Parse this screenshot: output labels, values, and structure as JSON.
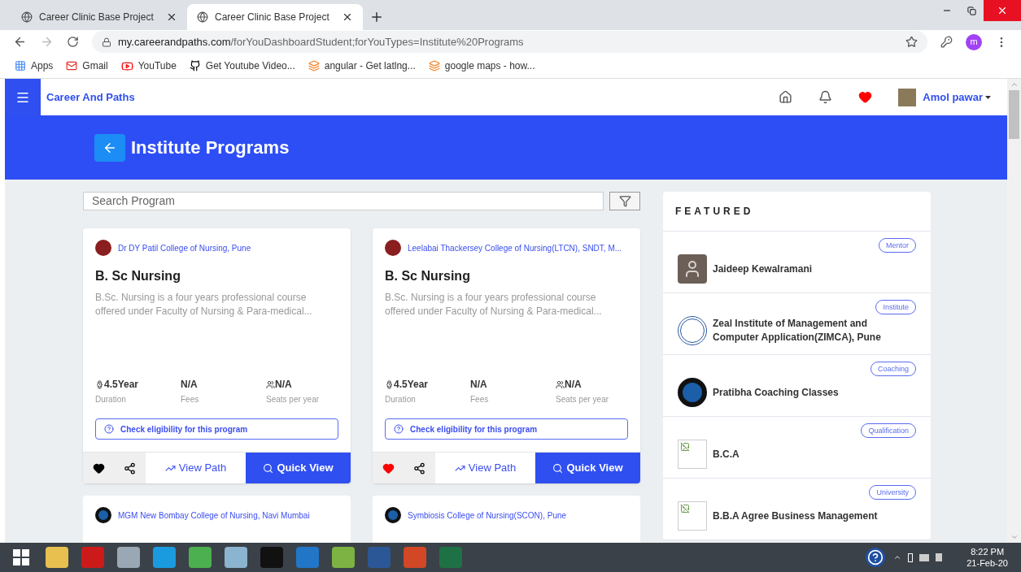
{
  "browser": {
    "tabs": [
      {
        "title": "Career Clinic Base Project",
        "selected": false
      },
      {
        "title": "Career Clinic Base Project",
        "selected": true
      }
    ],
    "url_host": "my.careerandpaths.com",
    "url_path": "/forYouDashboardStudent;forYouTypes=Institute%20Programs",
    "bookmarks": [
      {
        "label": "Apps",
        "kind": "apps"
      },
      {
        "label": "Gmail",
        "kind": "gmail"
      },
      {
        "label": "YouTube",
        "kind": "youtube"
      },
      {
        "label": "Get Youtube Video...",
        "kind": "github"
      },
      {
        "label": "angular - Get latlng...",
        "kind": "stack"
      },
      {
        "label": "google maps - how...",
        "kind": "stack"
      }
    ],
    "profile_initial": "m"
  },
  "app": {
    "brand": "Career And Paths",
    "user": "Amol pawar",
    "page_title": "Institute Programs",
    "search_placeholder": "Search Program",
    "programs": [
      {
        "institute": "Dr DY Patil College of Nursing, Pune",
        "title": "B. Sc Nursing",
        "description": "B.Sc. Nursing is a four years professional course offered under Faculty of Nursing & Para-medical...",
        "duration": "4.5Year",
        "duration_label": "Duration",
        "fees": "N/A",
        "fees_label": "Fees",
        "seats": "N/A",
        "seats_label": "Seats per year",
        "eligibility": "Check eligibility for this program",
        "favorite": false,
        "view_path": "View Path",
        "quick_view": "Quick View"
      },
      {
        "institute": "Leelabai Thackersey College of Nursing(LTCN), SNDT, M...",
        "title": "B. Sc Nursing",
        "description": "B.Sc. Nursing is a four years professional course offered under Faculty of Nursing & Para-medical...",
        "duration": "4.5Year",
        "duration_label": "Duration",
        "fees": "N/A",
        "fees_label": "Fees",
        "seats": "N/A",
        "seats_label": "Seats per year",
        "eligibility": "Check eligibility for this program",
        "favorite": true,
        "view_path": "View Path",
        "quick_view": "Quick View"
      }
    ],
    "more_programs": [
      {
        "institute": "MGM New Bombay College of Nursing, Navi Mumbai"
      },
      {
        "institute": "Symbiosis College of Nursing(SCON), Pune"
      }
    ],
    "featured": {
      "title": "FEATURED",
      "items": [
        {
          "tag": "Mentor",
          "name": "Jaideep Kewalramani",
          "kind": "photo"
        },
        {
          "tag": "Institute",
          "name": "Zeal Institute of Management and Computer Application(ZIMCA), Pune",
          "kind": "seal"
        },
        {
          "tag": "Coaching",
          "name": "Pratibha Coaching Classes",
          "kind": "g-logo"
        },
        {
          "tag": "Qualification",
          "name": "B.C.A",
          "kind": "broken"
        },
        {
          "tag": "University",
          "name": "B.B.A Agree Business Management",
          "kind": "broken"
        }
      ]
    }
  },
  "taskbar": {
    "time": "8:22 PM",
    "date": "21-Feb-20"
  }
}
